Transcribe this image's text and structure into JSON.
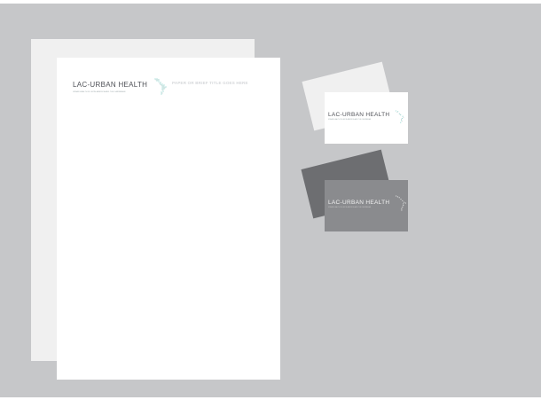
{
  "brand": {
    "name": "LAC-URBAN HEALTH",
    "tagline": "URBAN HEALTH IN LATIN AMERICA AND THE CARIBBEAN"
  },
  "letterhead": {
    "title_placeholder": "PAPER OR BRIEF TITLE GOES HERE"
  },
  "colors": {
    "background": "#c6c7c9",
    "paper": "#ffffff",
    "paper_back": "#f0f0f0",
    "logo_text": "#4f5157",
    "accent_teal": "#5fc3b8",
    "card_dark_back": "#6d6e71",
    "card_dark_front": "#8a8b8e"
  },
  "icons": [
    "latin-america-map-icon"
  ]
}
